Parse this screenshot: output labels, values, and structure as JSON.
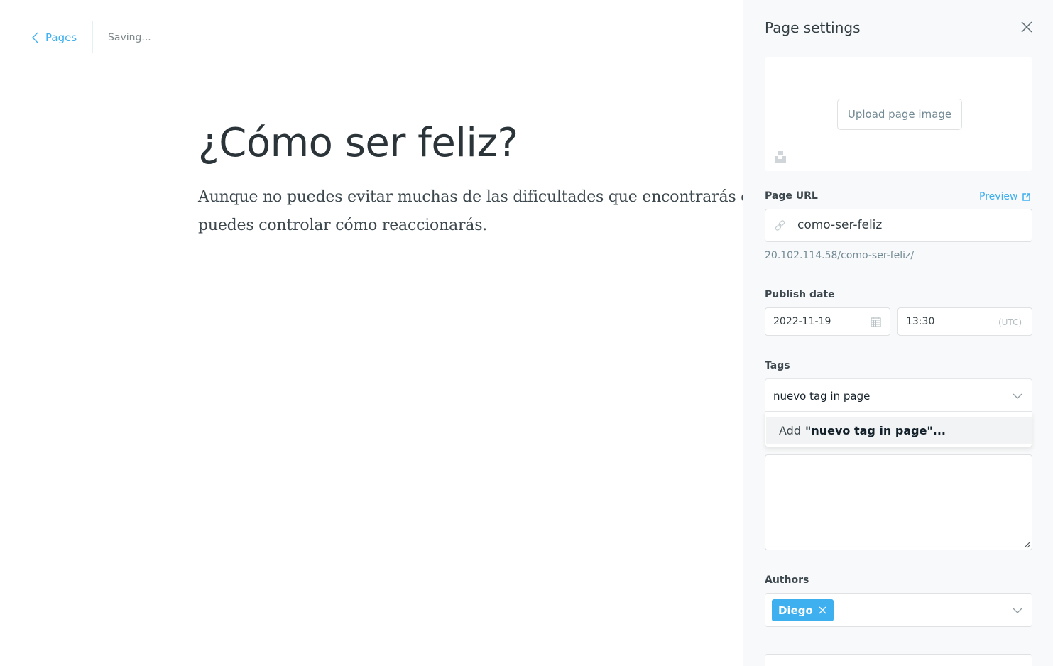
{
  "editor": {
    "back_label": "Pages",
    "status": "Saving...",
    "title": "¿Cómo ser feliz?",
    "body": "Aunque no puedes evitar muchas de las dificultades que encontrarás en la vida, puedes controlar cómo reaccionarás."
  },
  "settings": {
    "title": "Page settings",
    "upload_label": "Upload page image",
    "url_label": "Page URL",
    "preview_label": "Preview",
    "url_value": "como-ser-feliz",
    "full_url": "20.102.114.58/como-ser-feliz/",
    "publish_label": "Publish date",
    "date_value": "2022-11-19",
    "time_value": "13:30",
    "timezone": "(UTC)",
    "tags_label": "Tags",
    "tags_input_value": "nuevo tag in page",
    "tags_option_prefix": "Add",
    "tags_option_value": "\"nuevo tag in page\"...",
    "authors_label": "Authors",
    "authors": [
      "Diego"
    ]
  },
  "colors": {
    "accent": "#3eb0ef",
    "panel_bg": "#f8f9fa",
    "text": "#15212a",
    "muted": "#738a94"
  },
  "icons": {
    "back": "chevron-left-icon",
    "close": "close-icon",
    "unsplash": "unsplash-icon",
    "preview": "external-link-icon",
    "url": "link-icon",
    "date": "calendar-icon",
    "dropdown": "chevron-down-icon",
    "remove_author": "remove-x-icon"
  }
}
